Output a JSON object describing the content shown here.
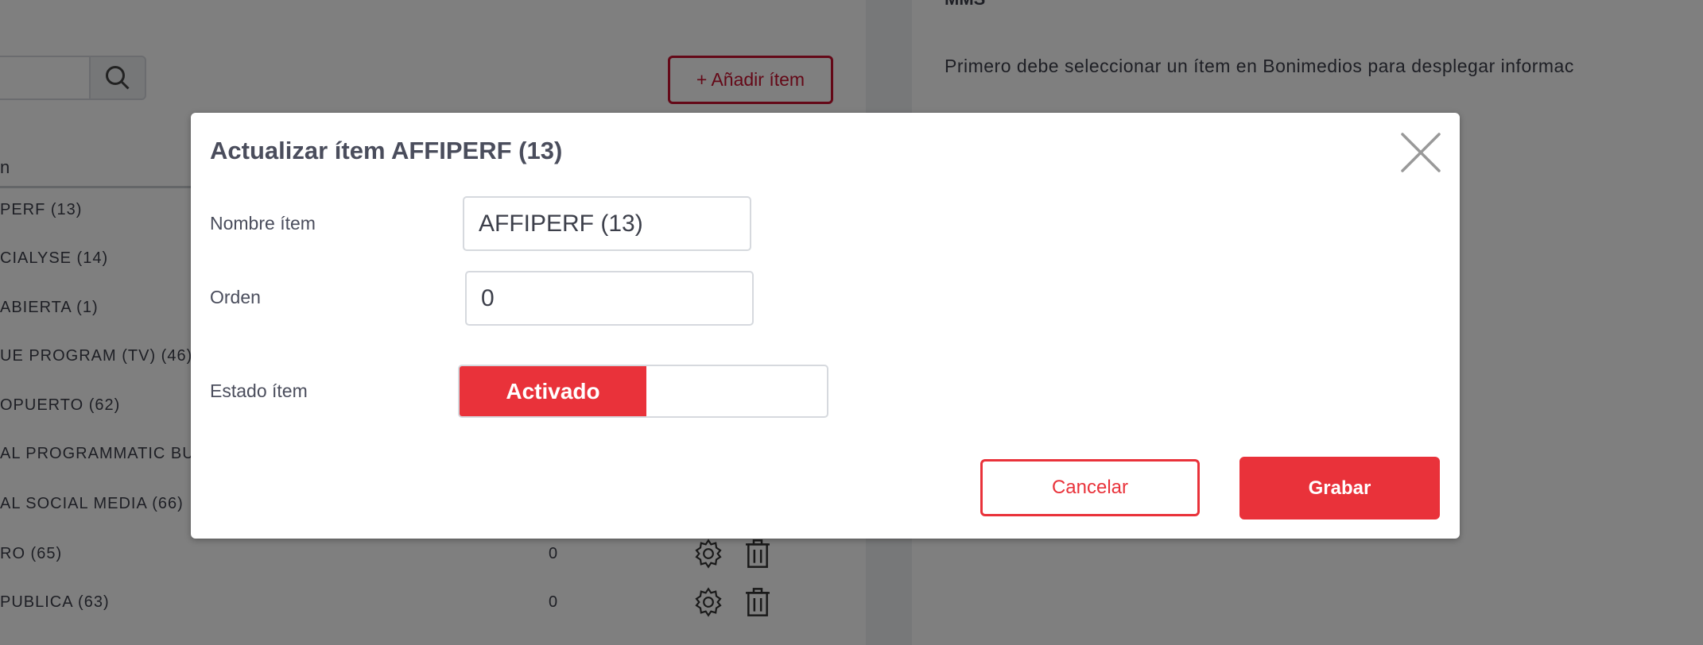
{
  "background": {
    "add_button": "+ Añadir ítem",
    "table_header": "n",
    "rows": [
      {
        "name": "PERF (13)",
        "order": ""
      },
      {
        "name": "CIALYSE (14)",
        "order": ""
      },
      {
        "name": "ABIERTA (1)",
        "order": ""
      },
      {
        "name": "UE PROGRAM (TV) (46)",
        "order": ""
      },
      {
        "name": "OPUERTO (62)",
        "order": ""
      },
      {
        "name": "AL PROGRAMMATIC BUY",
        "order": ""
      },
      {
        "name": "AL SOCIAL MEDIA (66)",
        "order": ""
      },
      {
        "name": "RO (65)",
        "order": "0"
      },
      {
        "name": "PUBLICA (63)",
        "order": "0"
      }
    ],
    "right_title": "MMS",
    "right_info": "Primero debe seleccionar un ítem en Bonimedios para desplegar informac"
  },
  "modal": {
    "title": "Actualizar ítem AFFIPERF (13)",
    "name_label": "Nombre ítem",
    "name_value": "AFFIPERF (13)",
    "order_label": "Orden",
    "order_value": "0",
    "status_label": "Estado ítem",
    "status_value": "Activado",
    "cancel": "Cancelar",
    "save": "Grabar"
  },
  "colors": {
    "accent": "#e9323a",
    "overlay": "rgba(0,0,0,0.5)"
  }
}
